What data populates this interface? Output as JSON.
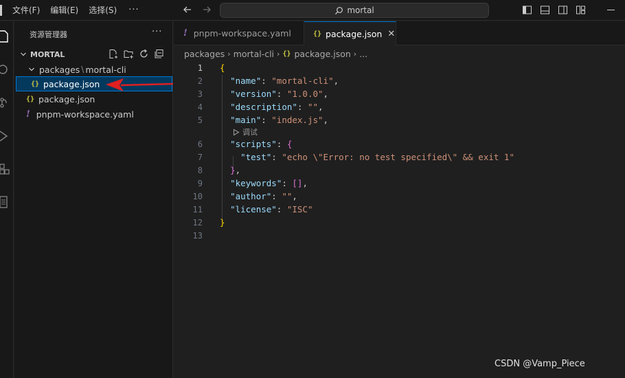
{
  "menu": {
    "file": "文件(F)",
    "edit": "编辑(E)",
    "selection": "选择(S)",
    "more": "···"
  },
  "search": {
    "text": "mortal"
  },
  "sidebar": {
    "header": "资源管理器",
    "more": "···",
    "folder_name": "MORTAL",
    "tree": {
      "row1": "packages",
      "row1b": "mortal-cli",
      "row2": "package.json",
      "row3": "package.json",
      "row4": "pnpm-workspace.yaml"
    }
  },
  "tabs": {
    "tab1": "pnpm-workspace.yaml",
    "tab2": "package.json",
    "close": "✕"
  },
  "breadcrumb": {
    "seg1": "packages",
    "seg2": "mortal-cli",
    "seg3": "package.json",
    "seg4": "..."
  },
  "code": {
    "ln": [
      "1",
      "2",
      "3",
      "4",
      "5",
      "6",
      "7",
      "8",
      "9",
      "10",
      "11",
      "12",
      "13"
    ],
    "codelens": "调试",
    "l1": "{",
    "l2k": "\"name\"",
    "l2v": "\"mortal-cli\"",
    "l3k": "\"version\"",
    "l3v": "\"1.0.0\"",
    "l4k": "\"description\"",
    "l4v": "\"\"",
    "l5k": "\"main\"",
    "l5v": "\"index.js\"",
    "l6k": "\"scripts\"",
    "l6b": "{",
    "l7k": "\"test\"",
    "l7v": "\"echo \\\"Error: no test specified\\\" && exit 1\"",
    "l8b": "}",
    "l9k": "\"keywords\"",
    "l9b": "[]",
    "l10k": "\"author\"",
    "l10v": "\"\"",
    "l11k": "\"license\"",
    "l11v": "\"ISC\"",
    "l12": "}",
    "colon": ": ",
    "comma": ","
  },
  "watermark": "CSDN @Vamp_Piece",
  "colors": {
    "accent": "#0078d4",
    "annotation_arrow": "#e02020"
  }
}
